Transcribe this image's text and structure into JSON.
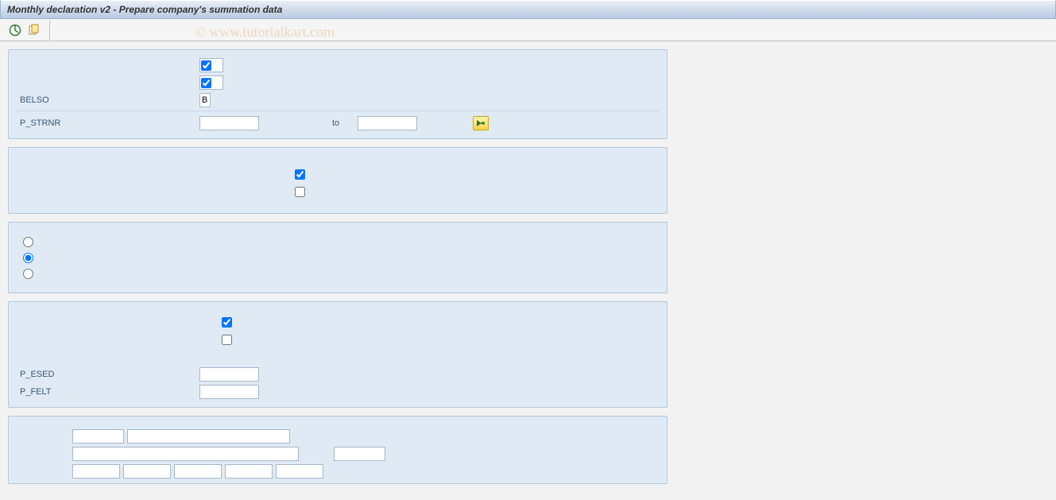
{
  "window": {
    "title": "Monthly declaration v2 - Prepare company's summation data"
  },
  "watermark": "© www.tutorialkart.com",
  "toolbar": {
    "execute_icon": "execute",
    "variant_icon": "variant"
  },
  "group1": {
    "chk1_checked": true,
    "chk2_checked": true,
    "belso_label": "BELSO",
    "belso_value": "B",
    "pstrnr_label": "P_STRNR",
    "pstrnr_from": "",
    "to_label": "to",
    "pstrnr_to": ""
  },
  "group2": {
    "chk1_checked": true,
    "chk2_checked": false
  },
  "group3": {
    "radio_selected": 1
  },
  "group4": {
    "chk1_checked": true,
    "chk2_checked": false,
    "pesed_label": "P_ESED",
    "pesed_value": "",
    "pfelt_label": "P_FELT",
    "pfelt_value": ""
  },
  "group5": {
    "f1": "",
    "f2": "",
    "f3": "",
    "f4": "",
    "f5": "",
    "f6": "",
    "f7": "",
    "f8": "",
    "f9": ""
  }
}
